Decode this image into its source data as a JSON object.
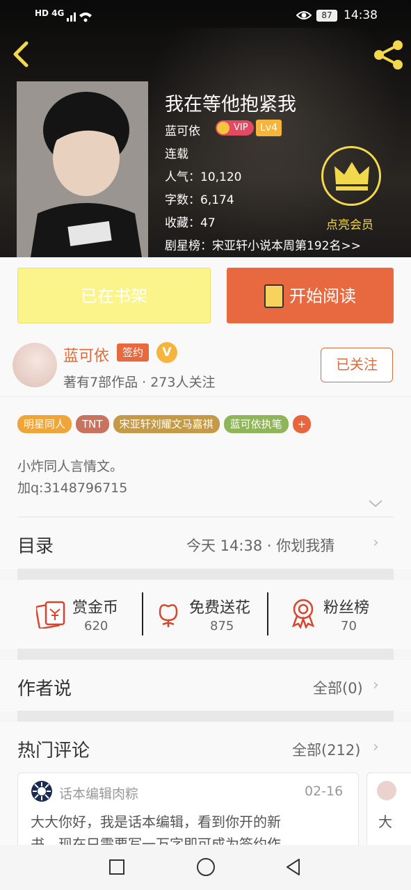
{
  "status_bar": {
    "left": "HD 4G",
    "battery": "87",
    "time": "14:38"
  },
  "book": {
    "title": "我在等他抱紧我",
    "author": "蓝可依",
    "vip_badge": "VIP",
    "level": "Lv4",
    "status": "连载",
    "popularity_label": "人气：",
    "popularity": "10,120",
    "word_count_label": "字数：",
    "word_count": "6,174",
    "favorites_label": "收藏：",
    "favorites": "47",
    "ranking": "剧星榜：宋亚轩小说本周第192名>>",
    "member_label": "点亮会员"
  },
  "actions": {
    "on_shelf": "已在书架",
    "start_reading": "开始阅读"
  },
  "author_info": {
    "name": "蓝可依",
    "signed": "签约",
    "v_badge": "V",
    "stats": "著有7部作品 · 273人关注",
    "follow_button": "已关注"
  },
  "tags": [
    {
      "label": "明星同人",
      "color": "#f0a53a"
    },
    {
      "label": "TNT",
      "color": "#c9735f"
    },
    {
      "label": "宋亚轩刘耀文马嘉祺",
      "color": "#c49a48"
    },
    {
      "label": "蓝可依执笔",
      "color": "#8fb55b"
    },
    {
      "label": "+",
      "color": "#e8663d"
    }
  ],
  "description": {
    "line1": "小炸同人言情文。",
    "line2": "加q:3148796715"
  },
  "catalog": {
    "title": "目录",
    "update": "今天 14:38 · 你划我猜"
  },
  "stats_row": [
    {
      "label": "赏金币",
      "value": "620",
      "icon": "red-envelope-icon"
    },
    {
      "label": "免费送花",
      "value": "875",
      "icon": "flower-icon"
    },
    {
      "label": "粉丝榜",
      "value": "70",
      "icon": "medal-icon"
    }
  ],
  "author_says": {
    "title": "作者说",
    "all": "全部(0)"
  },
  "hot_comments": {
    "title": "热门评论",
    "all": "全部(212)",
    "comment": {
      "user": "话本编辑肉粽",
      "date": "02-16",
      "text_line1": "大大你好，我是话本编辑，看到你开的新",
      "text_line2": "书，现在只需要写一万字即可成为签约作"
    },
    "next_comment_start": "大"
  },
  "colors": {
    "accent_orange": "#e8693f",
    "shelf_yellow": "#fbf48a",
    "gold": "#f3d64a"
  }
}
